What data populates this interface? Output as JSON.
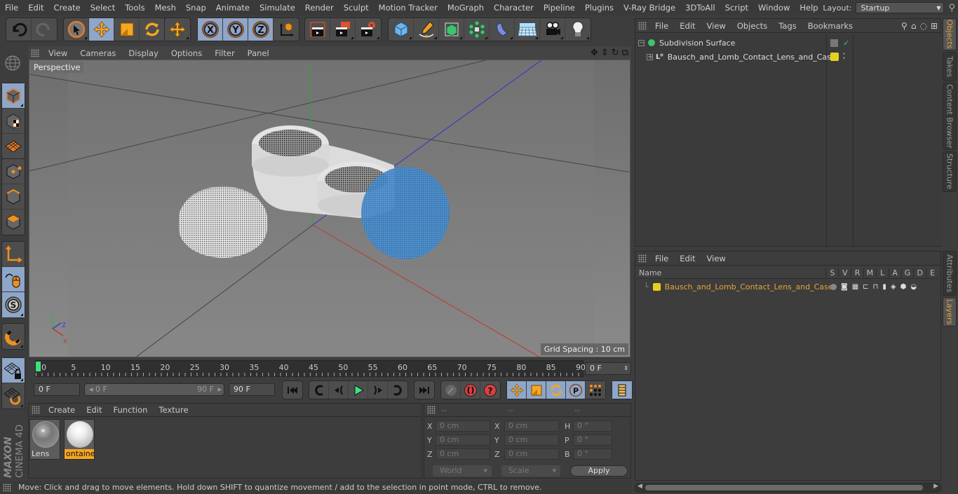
{
  "menubar": {
    "items": [
      "File",
      "Edit",
      "Create",
      "Select",
      "Tools",
      "Mesh",
      "Snap",
      "Animate",
      "Simulate",
      "Render",
      "Sculpt",
      "Motion Tracker",
      "MoGraph",
      "Character",
      "Pipeline",
      "Plugins",
      "V-Ray Bridge",
      "3DToAll",
      "Script",
      "Window",
      "Help"
    ],
    "layout_label": "Layout:",
    "layout_value": "Startup"
  },
  "toolbar": {
    "groups": [
      [
        "undo",
        "redo"
      ],
      [
        "live-selection",
        "move",
        "scale",
        "rotate"
      ],
      [
        "recent-tool"
      ],
      [
        "x-axis-lock",
        "y-axis-lock",
        "z-axis-lock",
        "coordinate-system"
      ],
      [
        "render-view",
        "render-picture-viewer",
        "render-settings"
      ],
      [
        "cube",
        "pen-spline",
        "subdivision-surface",
        "cloner",
        "deformer-bend",
        "floor",
        "camera",
        "light"
      ]
    ]
  },
  "viewport": {
    "menu": [
      "View",
      "Cameras",
      "Display",
      "Options",
      "Filter",
      "Panel"
    ],
    "camera_label": "Perspective",
    "grid_spacing": "Grid Spacing : 10 cm",
    "axis_labels": {
      "x": "X",
      "y": "Y",
      "z": "Z"
    }
  },
  "timeline": {
    "ticks": [
      "0",
      "5",
      "10",
      "15",
      "20",
      "25",
      "30",
      "35",
      "40",
      "45",
      "50",
      "55",
      "60",
      "65",
      "70",
      "75",
      "80",
      "85",
      "90"
    ],
    "current_frame": "0 F",
    "start_field": "0 F",
    "range_start": "0 F",
    "range_end": "90 F",
    "end_field": "90 F"
  },
  "material_panel": {
    "menu": [
      "Create",
      "Edit",
      "Function",
      "Texture"
    ],
    "materials": [
      {
        "name": "Lens",
        "selected": false
      },
      {
        "name": "ontaine",
        "selected": true
      }
    ]
  },
  "coordinates": {
    "headers": [
      "--",
      "--",
      "--"
    ],
    "rows": [
      {
        "l1": "X",
        "v1": "0 cm",
        "l2": "X",
        "v2": "0 cm",
        "l3": "H",
        "v3": "0 °"
      },
      {
        "l1": "Y",
        "v1": "0 cm",
        "l2": "Y",
        "v2": "0 cm",
        "l3": "P",
        "v3": "0 °"
      },
      {
        "l1": "Z",
        "v1": "0 cm",
        "l2": "Z",
        "v2": "0 cm",
        "l3": "B",
        "v3": "0 °"
      }
    ],
    "mode_dropdown": "World",
    "size_dropdown": "Scale",
    "apply_label": "Apply"
  },
  "status": {
    "text": "Move: Click and drag to move elements. Hold down SHIFT to quantize movement / add to the selection in point mode, CTRL to remove."
  },
  "logo": {
    "brand": "MAXON",
    "product": "CINEMA 4D"
  },
  "object_manager": {
    "menu": [
      "File",
      "Edit",
      "View",
      "Objects",
      "Tags",
      "Bookmarks"
    ],
    "objects": [
      {
        "name": "Subdivision Surface",
        "level": 0,
        "expand": "−"
      },
      {
        "name": "Bausch_and_Lomb_Contact_Lens_and_Case",
        "level": 1,
        "expand": "+"
      }
    ]
  },
  "side_tabs": {
    "top": [
      {
        "label": "Objects",
        "active": true
      },
      {
        "label": "Takes",
        "active": false
      },
      {
        "label": "Content Browser",
        "active": false
      },
      {
        "label": "Structure",
        "active": false
      }
    ],
    "bottom": [
      {
        "label": "Attributes",
        "active": false
      },
      {
        "label": "Layers",
        "active": true
      }
    ]
  },
  "layer_manager": {
    "menu": [
      "File",
      "Edit",
      "View"
    ],
    "columns": [
      "Name",
      "S",
      "V",
      "R",
      "M",
      "L",
      "A",
      "G",
      "D",
      "E"
    ],
    "layers": [
      {
        "name": "Bausch_and_Lomb_Contact_Lens_and_Case",
        "color": "#e6d21e"
      }
    ]
  },
  "colors": {
    "accent_orange": "#e8a23b",
    "selected_blue": "#8ea6c9",
    "layer_yellow": "#e6d21e",
    "axis_x": "#c0392b",
    "axis_y": "#3ab03a",
    "axis_z": "#3a3ad0"
  }
}
